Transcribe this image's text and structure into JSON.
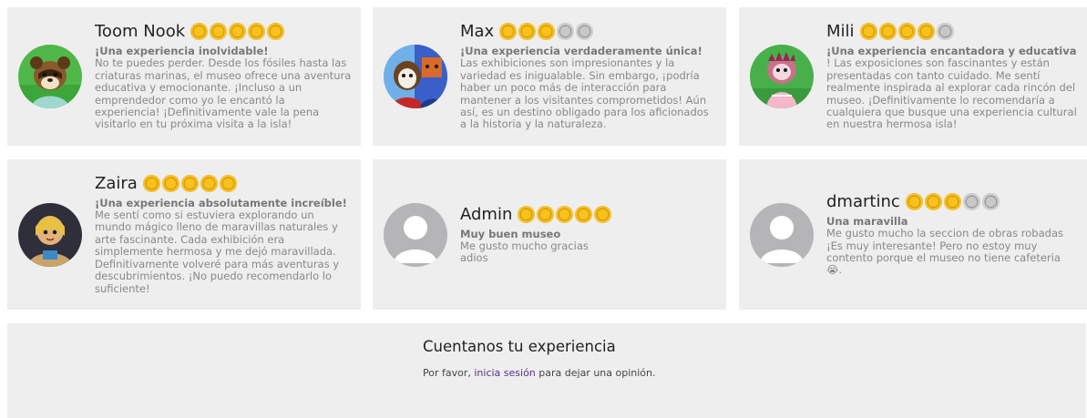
{
  "reviews": [
    {
      "name": "Toom Nook",
      "rating": 5,
      "title": "¡Una experiencia inolvidable!",
      "body": "No te puedes perder. Desde los fósiles hasta las criaturas marinas, el museo ofrece una aventura educativa y emocionante. ¡Incluso a un emprendedor como yo le encantó la experiencia! ¡Definitivamente vale la pena visitarlo en tu próxima visita a la isla!",
      "avatar": "tom-nook-avatar"
    },
    {
      "name": "Max",
      "rating": 3,
      "title": "¡Una experiencia verdaderamente única!",
      "body": "Las exhibiciones son impresionantes y la variedad es inigualable. Sin embargo, ¡podría haber un poco más de interacción para mantener a los visitantes comprometidos! Aún así, es un destino obligado para los aficionados a la historia y la naturaleza.",
      "avatar": "max-avatar"
    },
    {
      "name": "Mili",
      "rating": 4,
      "title": "¡Una experiencia encantadora y educativa",
      "body": "! Las exposiciones son fascinantes y están presentadas con tanto cuidado. Me sentí realmente inspirada al explorar cada rincón del museo. ¡Definitivamente lo recomendaría a cualquiera que busque una experiencia cultural en nuestra hermosa isla!",
      "avatar": "mili-avatar"
    },
    {
      "name": "Zaira",
      "rating": 5,
      "title": "¡Una experiencia absolutamente increíble!",
      "body": "Me sentí como si estuviera explorando un mundo mágico lleno de maravillas naturales y arte fascinante. Cada exhibición era simplemente hermosa y me dejó maravillada. Definitivamente volveré para más aventuras y descubrimientos. ¡No puedo recomendarlo lo suficiente!",
      "avatar": "zaira-avatar"
    },
    {
      "name": "Admin",
      "rating": 5,
      "title": "Muy buen museo",
      "body": "Me gusto mucho gracias adios",
      "avatar": "default-user-avatar"
    },
    {
      "name": "dmartinc",
      "rating": 3,
      "title": "Una maravilla",
      "body": "Me gusto mucho la seccion de obras robadas ¡Es muy interesante! Pero no estoy muy contento porque el museo no tiene cafeteria 😭.",
      "avatar": "default-user-avatar"
    }
  ],
  "feedback": {
    "heading": "Cuentanos tu experiencia",
    "prefix": "Por favor, ",
    "link": "inicia sesión",
    "suffix": " para dejar una opinión."
  },
  "colors": {
    "card_bg": "#eeeeee",
    "coin_gold": "#f5c12a",
    "coin_grey": "#c8c8c8",
    "link": "#5b2d8a"
  }
}
